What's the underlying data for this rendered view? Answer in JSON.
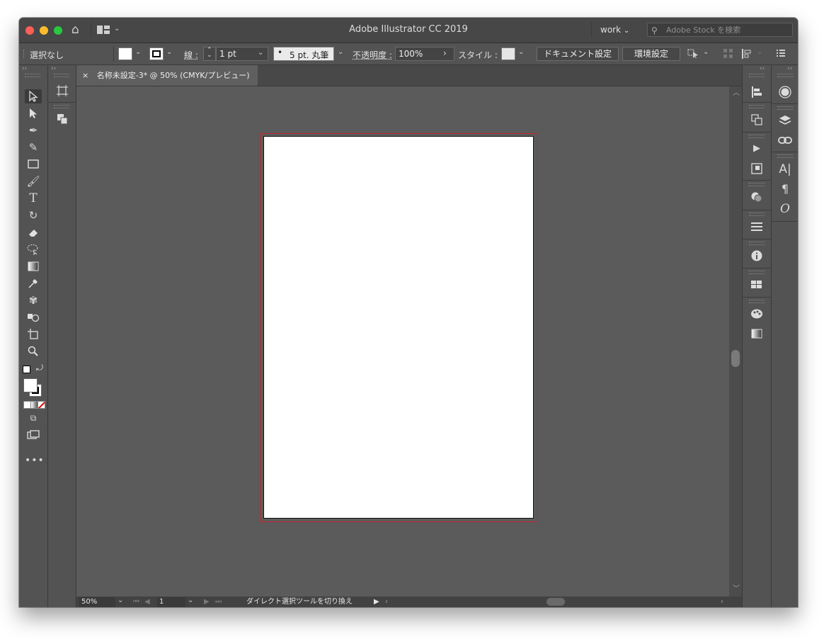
{
  "window": {
    "title": "Adobe Illustrator CC 2019",
    "workspace": "work",
    "search_placeholder": "Adobe Stock を検索"
  },
  "control_bar": {
    "selection_state": "選択なし",
    "stroke_label": "線 :",
    "stroke_weight": "1 pt",
    "brush_label": "5 pt. 丸筆",
    "opacity_label": "不透明度 :",
    "opacity_value": "100%",
    "style_label": "スタイル :",
    "document_setup_label": "ドキュメント設定",
    "preferences_label": "環境設定"
  },
  "document_tab": {
    "close_glyph": "×",
    "title": "名称未設定-3* @ 50% (CMYK/プレビュー)"
  },
  "status_bar": {
    "zoom": "50%",
    "artboard_number": "1",
    "status_text": "ダイレクト選択ツールを切り換え"
  },
  "colors": {
    "artboard_bleed": "#c1272d",
    "artboard": "#ffffff",
    "canvas": "#5b5b5b"
  },
  "left_tools": [
    "selection-tool",
    "direct-selection-tool",
    "pen-tool",
    "curvature-tool",
    "rectangle-tool",
    "paintbrush-tool",
    "type-tool",
    "rotate-tool",
    "eraser-tool",
    "lasso-tool",
    "gradient-tool",
    "eyedropper-tool",
    "puppet-warp-tool",
    "shape-builder-tool",
    "artboard-tool",
    "zoom-tool"
  ],
  "right_panels": [
    "align-panel",
    "transform-panel",
    "actions-panel",
    "libraries-panel",
    "appearance-panel",
    "stroke-panel",
    "info-panel",
    "swatches-panel",
    "color-guide-panel",
    "gradient-panel"
  ],
  "far_right_panels": [
    "color-panel",
    "layers-panel",
    "links-panel",
    "character-panel",
    "paragraph-panel",
    "opentype-panel"
  ]
}
